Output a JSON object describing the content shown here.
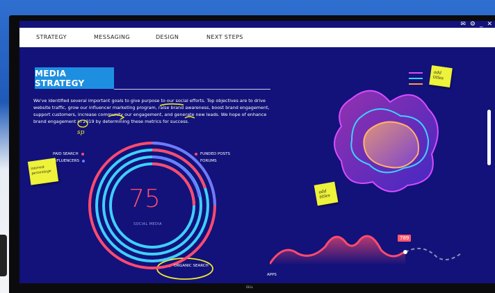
{
  "window_controls": [
    "✉",
    "⚙",
    "_",
    "✕"
  ],
  "nav": {
    "tabs": [
      "STRATEGY",
      "MESSAGING",
      "DESIGN",
      "NEXT STEPS"
    ]
  },
  "title": "MEDIA STRATEGY",
  "paragraph": "We've identified several important goals to give purpose to our social efforts. Top objectives are to drive website traffic, grow our influencer marketing program, raise brand awareness, boost brand engagement, support customers, increase community our engagement, and generate new leads. We hope of enhance brand engagement in 2019 by determining these metrics for success.",
  "legend_left": [
    {
      "label": "PAID SEARCH",
      "color": "#ff4b6e"
    },
    {
      "label": "INFLUENCERS",
      "color": "#6b7cff"
    }
  ],
  "legend_right": [
    {
      "label": "FUNDED POSTS",
      "color": "#ff4b6e"
    },
    {
      "label": "FORUMS",
      "color": "#3fd0ff"
    }
  ],
  "ring_value": "75",
  "ring_label": "SOCIAL MEDIA",
  "organic_label": "ORGANIC SEARCH",
  "apps_label": "APPS",
  "area_badge": "789",
  "sticky_notes": {
    "top_right": "add titles",
    "middle": "add titles",
    "left": "interest percentage"
  },
  "handwriting": {
    "sp_mark": "sp"
  },
  "brand_text": "DELL",
  "colors": {
    "background": "#12127a",
    "accent_blue": "#1e8fe0",
    "pink": "#ff4b6e",
    "cyan": "#3fd0ff",
    "sticky": "#eef23a"
  }
}
